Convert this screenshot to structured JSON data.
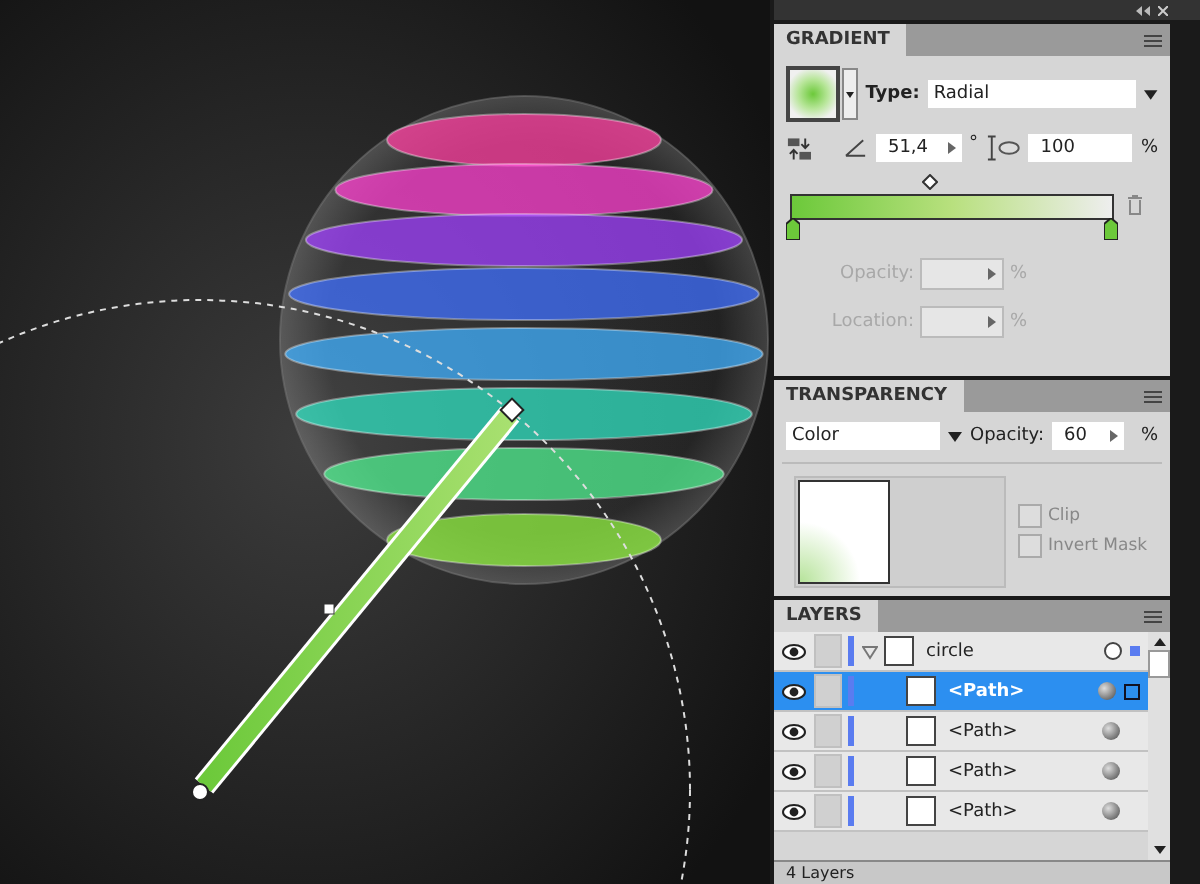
{
  "gradient": {
    "title": "GRADIENT",
    "type_label": "Type:",
    "type_value": "Radial",
    "angle": "51,4",
    "degree": "°",
    "aspect": "100",
    "percent": "%",
    "opacity_label": "Opacity:",
    "opacity_percent": "%",
    "location_label": "Location:",
    "location_percent": "%",
    "fields_disabled": true
  },
  "transparency": {
    "title": "TRANSPARENCY",
    "mode": "Color",
    "opacity_label": "Opacity:",
    "opacity": "60",
    "percent": "%",
    "options": [
      {
        "label": "Clip",
        "checked": false
      },
      {
        "label": "Invert Mask",
        "checked": false
      }
    ]
  },
  "layers": {
    "title": "LAYERS",
    "rows": [
      {
        "name": "circle",
        "expanded": true,
        "selected": false,
        "children": [
          {
            "name": "<Path>",
            "selected": true
          },
          {
            "name": "<Path>",
            "selected": false
          },
          {
            "name": "<Path>",
            "selected": false
          },
          {
            "name": "<Path>",
            "selected": false
          }
        ]
      }
    ],
    "count": "4 Layers"
  }
}
